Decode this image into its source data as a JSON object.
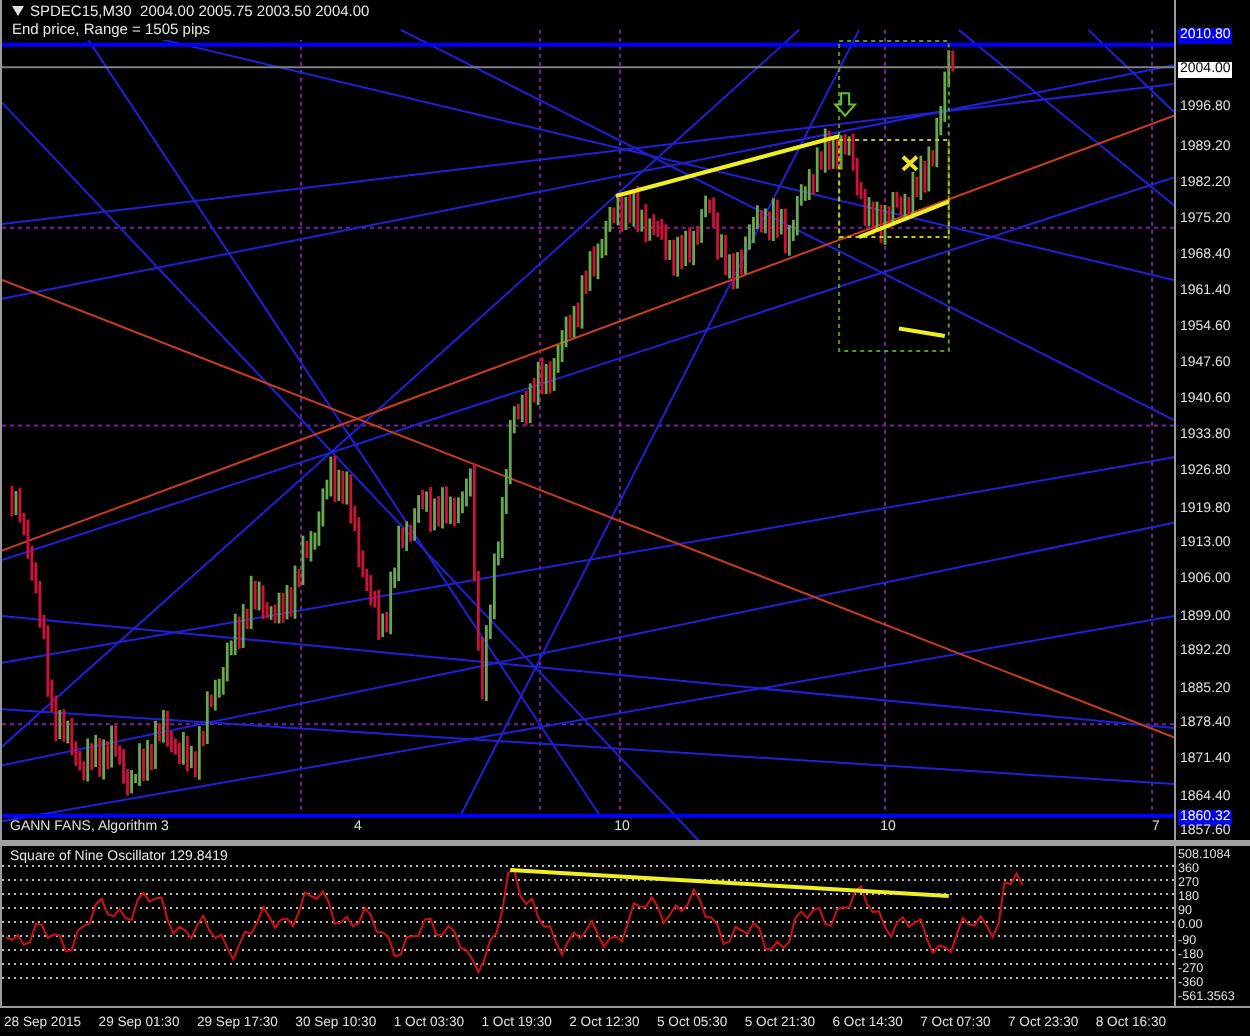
{
  "chart": {
    "symbol_line": "SPDEC15,M30  2004.00 2005.75 2003.50 2004.00",
    "info_line": "End price, Range = 1505 pips",
    "subwindow_label": "GANN FANS, Algorithm 3",
    "period_marks": [
      "4",
      "10",
      "10",
      "7"
    ],
    "price_labels": [
      {
        "text": "2010.80",
        "kind": "marker"
      },
      {
        "text": "2004.00",
        "kind": "current"
      },
      {
        "text": "1996.80",
        "kind": "tick"
      },
      {
        "text": "1989.20",
        "kind": "tick"
      },
      {
        "text": "1982.20",
        "kind": "tick"
      },
      {
        "text": "1975.20",
        "kind": "tick"
      },
      {
        "text": "1968.40",
        "kind": "tick"
      },
      {
        "text": "1961.40",
        "kind": "tick"
      },
      {
        "text": "1954.60",
        "kind": "tick"
      },
      {
        "text": "1947.60",
        "kind": "tick"
      },
      {
        "text": "1940.60",
        "kind": "tick"
      },
      {
        "text": "1933.80",
        "kind": "tick"
      },
      {
        "text": "1926.80",
        "kind": "tick"
      },
      {
        "text": "1919.80",
        "kind": "tick"
      },
      {
        "text": "1913.00",
        "kind": "tick"
      },
      {
        "text": "1906.00",
        "kind": "tick"
      },
      {
        "text": "1899.00",
        "kind": "tick"
      },
      {
        "text": "1892.20",
        "kind": "tick"
      },
      {
        "text": "1885.20",
        "kind": "tick"
      },
      {
        "text": "1878.40",
        "kind": "tick"
      },
      {
        "text": "1871.40",
        "kind": "tick"
      },
      {
        "text": "1864.40",
        "kind": "tick"
      },
      {
        "text": "1860.32",
        "kind": "marker"
      },
      {
        "text": "1857.60",
        "kind": "tick"
      }
    ]
  },
  "oscillator": {
    "label": "Square of Nine Oscillator 129.8419",
    "scale_labels": [
      "508.1084",
      "360",
      "270",
      "180",
      "90",
      "0.00",
      "-90",
      "-180",
      "-270",
      "-360",
      "-561.3563"
    ]
  },
  "time_labels": [
    "28 Sep 2015",
    "29 Sep 01:30",
    "29 Sep 17:30",
    "30 Sep 10:30",
    "1 Oct 03:30",
    "1 Oct 19:30",
    "2 Oct 12:30",
    "5 Oct 05:30",
    "5 Oct 21:30",
    "6 Oct 14:30",
    "7 Oct 07:30",
    "7 Oct 23:30",
    "8 Oct 16:30"
  ]
}
